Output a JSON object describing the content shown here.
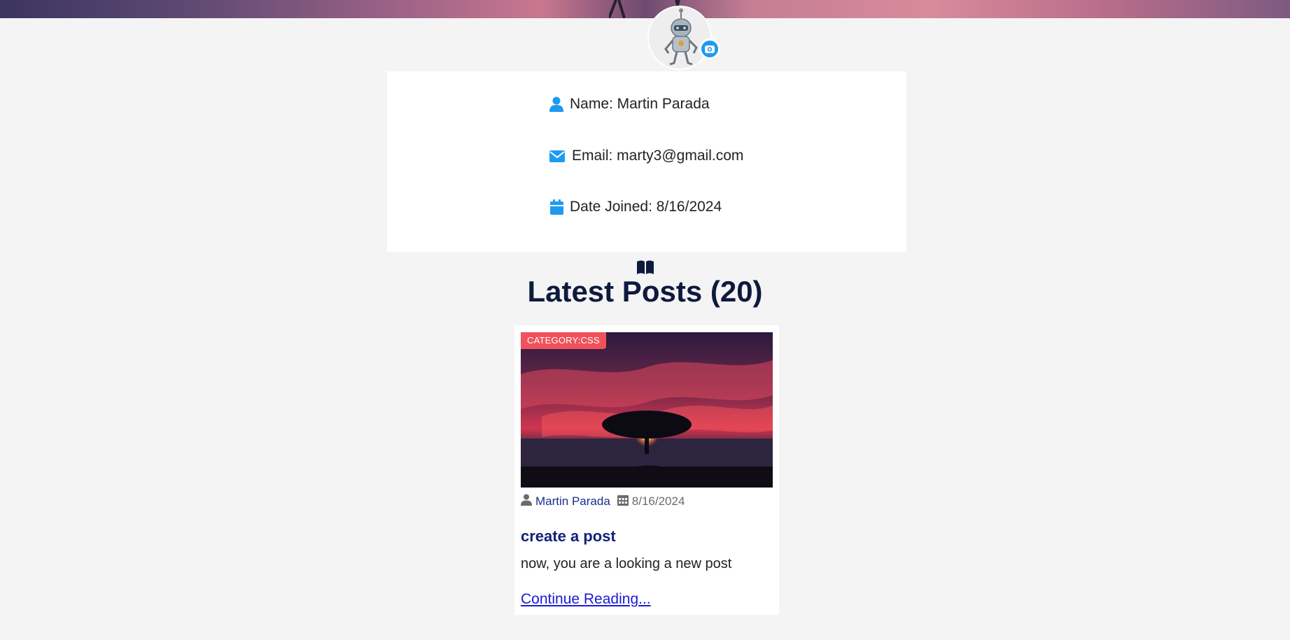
{
  "profile": {
    "name_label": "Name: Martin Parada",
    "email_label": "Email: marty3@gmail.com",
    "joined_label": "Date Joined: 8/16/2024"
  },
  "posts_section": {
    "title": "Latest Posts (20)"
  },
  "post": {
    "category_badge": "CATEGORY:CSS",
    "author": "Martin Parada",
    "date": "8/16/2024",
    "title": "create a post",
    "excerpt": "now, you are a looking a new post",
    "continue_label": "Continue Reading..."
  },
  "colors": {
    "accent": "#1e9bf0",
    "badge": "#f0525b",
    "heading": "#0e1a3d",
    "link": "#1a1ad6"
  }
}
